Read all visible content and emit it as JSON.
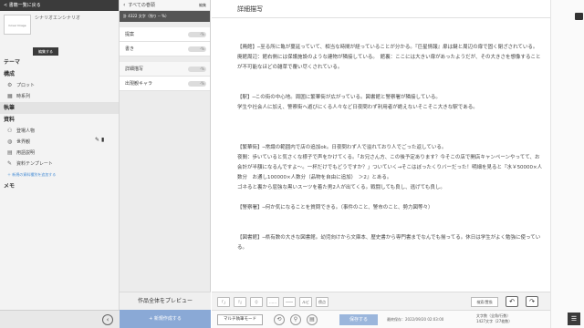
{
  "sidebar": {
    "back_label": "< 書籍一覧に戻る",
    "project_thumb": "Cover Image",
    "project_title": "シナリオエンシナリオ",
    "edit_label": "編集する",
    "sections": {
      "theme": "テーマ",
      "structure": "構成",
      "plot": "プロット",
      "timeline": "時系列",
      "writing": "執筆",
      "resources": "資料",
      "characters": "登場人物",
      "world": "世界観",
      "terms": "用語説明",
      "template": "資料テンプレート",
      "add_template": "＋ 新規の資料種別を追加する",
      "memo": "メモ"
    },
    "collapse_icon": "‹"
  },
  "episodes": {
    "header_label": "すべての巻頭",
    "edit_label": "編集",
    "count_label": "計 4322 文字（残り -- %）",
    "items": [
      {
        "label": "提案",
        "pill": "-%"
      },
      {
        "label": "書き",
        "pill": "-%"
      },
      {
        "label": "詳細描写",
        "pill": "-%"
      },
      {
        "label": "出現観キャラ",
        "pill": "-%"
      }
    ],
    "preview_label": "作品全体をプレビュー",
    "new_label": "+ 新規作成する"
  },
  "editor": {
    "title": "詳細描写",
    "paragraphs": [
      "",
      "【廃館】─至る所に亀が蔓延っていて、相当な時間が経っていることが分かる。『巨星情報』扉は鍵と周辺の扉で固く閉ざされている。",
      "廃館周辺：館右側には保護施設のような建物が隣接している。　館裏：ここには大きい扉があったようだが、その大きさを想像することが不可能なほどの雑草で覆い尽くされている。",
      "",
      "",
      "【駅】─この街の中心地。周囲に繁華街が広がっている。図書館と警察署が隣接している。",
      "学生や社会人に加え、警察街へ遊びにくる人々など日夜問わず利用者が絶えないそこそこ大きな駅である。",
      "",
      "",
      "",
      "【繁華街】─常識の範囲内で店の追加ok。日夜問わず人で溢れており人でごった返している。",
      "夜間：歩いていると気さくな様子で声をかけてくる。「お兄さん方、この後予定あります？今そこの店で開店キャンペーンやってて、お会計が半額になるんですよ～。一杯だけでもどうですか？」ついていく→そこはぼったくりバーだった！明細を見ると『水￥50000×人数分　お通し100000×人数分（品物を自由に追加）　＞2』とある。",
      "ゴネると裏から屈強な黒いスーツを着た男2人が出てくる。戦闘しても良し、逃げても良し。",
      "",
      "【警察署】─何か気になることを質問できる。（事件のこと、警市のこと、勢力図等々）",
      "",
      "",
      "【図書館】─県有数の大きな図書館。幼児向けから文庫本、歴史書から専門書までなんでも揃ってる。休日は学生がよく勉強に使っている。"
    ]
  },
  "toolbar": {
    "btn1": "「」",
    "btn2": "『』",
    "btn3": "（）",
    "btn4": "……",
    "btn5": "――",
    "ruby": "ルビ",
    "dot": "傍点",
    "search_label": "検索/置換",
    "undo_icon": "↶",
    "redo_icon": "↷"
  },
  "bottom": {
    "mode_label": "マルチ執筆モード",
    "save_label": "保存する",
    "save_info": "最終保存：2022/09/20 02:03:00",
    "count_line1": "文字数（全角/行数）",
    "count_line2": "1427文字（27枚数）",
    "menu_icon": "☰"
  }
}
